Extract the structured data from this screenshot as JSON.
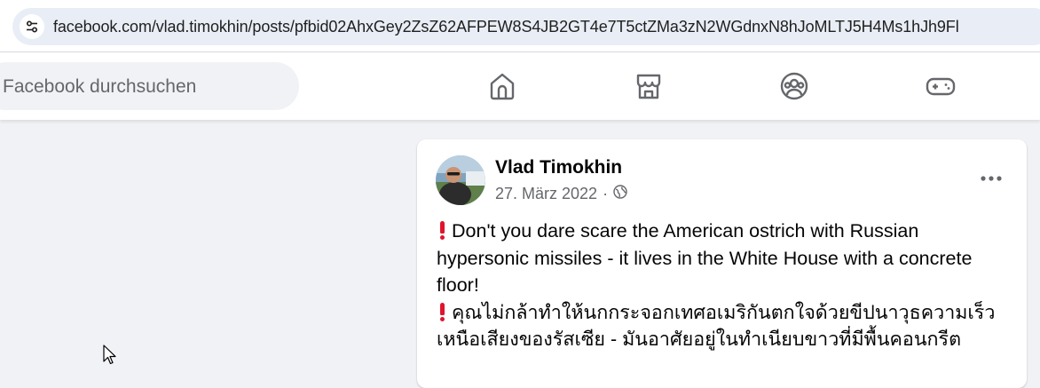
{
  "browser": {
    "url": "facebook.com/vlad.timokhin/posts/pfbid02AhxGey2ZsZ62AFPEW8S4JB2GT4e7T5ctZMa3zN2WGdnxN8hJoMLTJ5H4Ms1hJh9Fl",
    "site_info_icon": "tune-icon"
  },
  "header": {
    "search_placeholder": "Facebook durchsuchen",
    "nav_icons": [
      "home-icon",
      "marketplace-icon",
      "groups-icon",
      "gaming-icon"
    ]
  },
  "post": {
    "author": "Vlad Timokhin",
    "date": "27. März 2022",
    "separator": "·",
    "audience_icon": "globe-icon",
    "menu_icon": "more-icon",
    "lines": [
      "Don't you dare scare the American ostrich with Russian hypersonic missiles -  it lives in the White House with a concrete floor!",
      "คุณไม่กล้าทำให้นกกระจอกเทศอเมริกันตกใจด้วยขีปนาวุธความเร็วเหนือเสียงของรัสเซีย - มันอาศัยอยู่ในทำเนียบขาวที่มีพื้นคอนกรีต"
    ]
  },
  "colors": {
    "page_bg": "#f0f2f5",
    "text_primary": "#050505",
    "text_secondary": "#65676b",
    "icon": "#65676b",
    "exclamation": "#e0142c"
  }
}
